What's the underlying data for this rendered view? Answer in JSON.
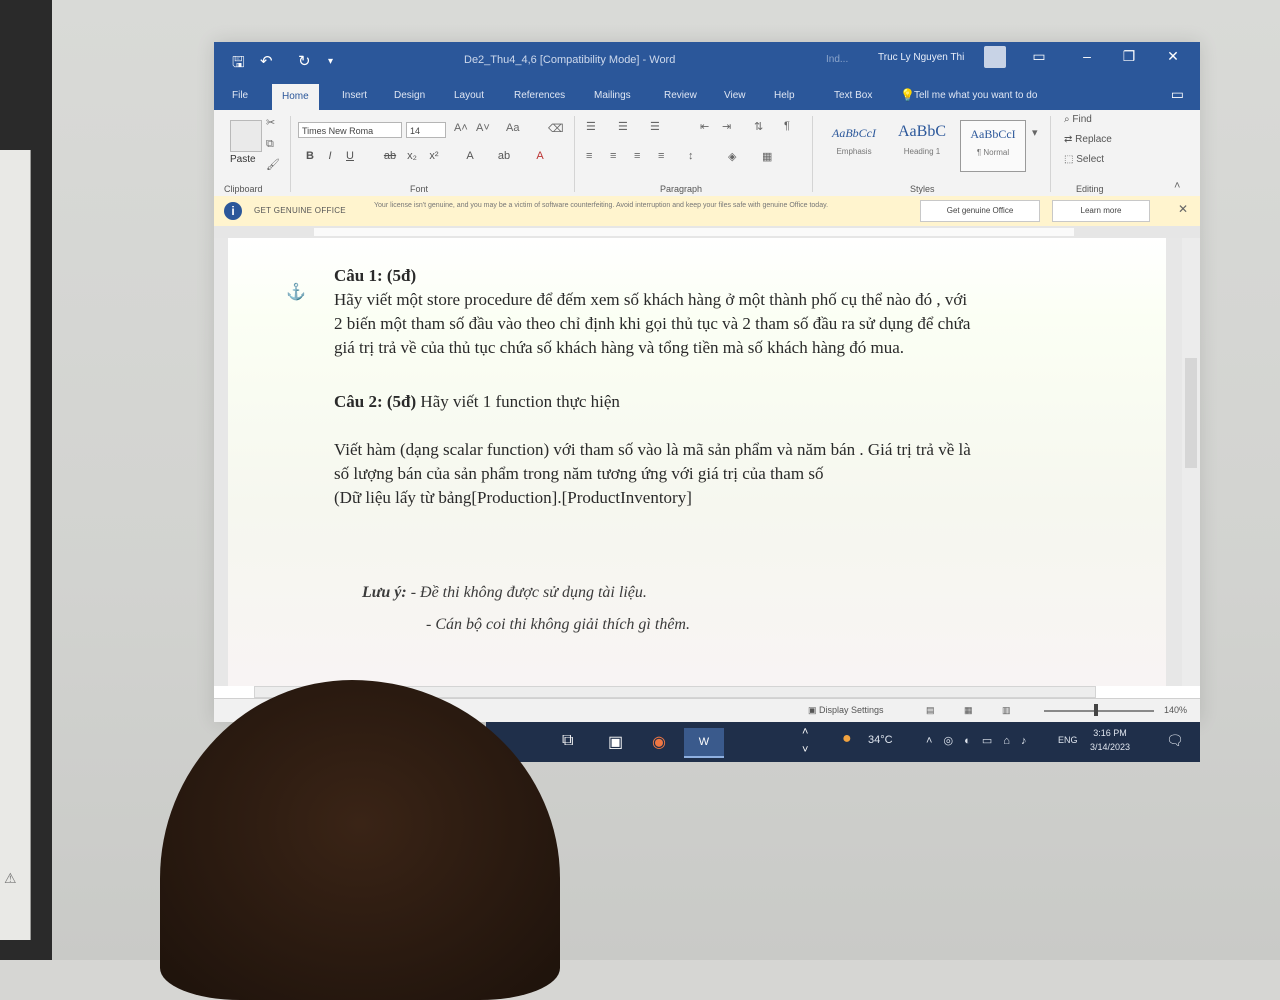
{
  "window": {
    "title": "De2_Thu4_4,6 [Compatibility Mode] - Word",
    "search_stub": "Ind...",
    "user": "Truc Ly Nguyen Thi"
  },
  "tabs": [
    {
      "label": "File"
    },
    {
      "label": "Home",
      "active": true
    },
    {
      "label": "Insert"
    },
    {
      "label": "Design"
    },
    {
      "label": "Layout"
    },
    {
      "label": "References"
    },
    {
      "label": "Mailings"
    },
    {
      "label": "Review"
    },
    {
      "label": "View"
    },
    {
      "label": "Help"
    },
    {
      "label": "Text Box"
    }
  ],
  "tell_me": "Tell me what you want to do",
  "ribbon": {
    "paste": "Paste",
    "font_name": "Times New Roma",
    "font_size": "14",
    "groups": {
      "clipboard": "Clipboard",
      "font": "Font",
      "paragraph": "Paragraph",
      "styles": "Styles",
      "editing": "Editing"
    },
    "styles": [
      {
        "sample": "AaBbCcI",
        "name": "Emphasis"
      },
      {
        "sample": "AaBbC",
        "name": "Heading 1"
      },
      {
        "sample": "AaBbCcI",
        "name": "¶ Normal"
      }
    ],
    "editing": {
      "find": "Find",
      "replace": "Replace",
      "select": "Select"
    }
  },
  "warning": {
    "title": "GET GENUINE OFFICE",
    "text": "Your license isn't genuine, and you may be a victim of software counterfeiting. Avoid interruption and keep your files safe with genuine Office today.",
    "btn_genuine": "Get genuine Office",
    "btn_learn": "Learn more"
  },
  "document": {
    "q1_head": "Câu 1: (5đ)",
    "q1_line1": "Hãy viết một store procedure để đếm xem số khách hàng ở một thành phố cụ thể nào đó , với",
    "q1_line2": "2 biến một tham số đầu vào theo chỉ định khi gọi thủ tục và 2 tham số đầu ra sử dụng để chứa",
    "q1_line3": "giá trị trả về của thủ tục chứa số khách hàng và tổng tiền mà số khách hàng đó mua.",
    "q2_head": "Câu 2: (5đ)",
    "q2_title_rest": " Hãy viết 1 function thực hiện",
    "q2_line1": "Viết hàm  (dạng scalar function) với tham số vào là mã sản phẩm và năm bán . Giá trị trả về là",
    "q2_line2": "số lượng bán của sản phẩm trong năm tương ứng với giá trị của tham số",
    "q2_line3": " (Dữ liệu lấy từ bảng[Production].[ProductInventory]",
    "note_label": "Lưu ý:",
    "note_1": " - Đề thi không được sử dụng tài liệu.",
    "note_2": "- Cán bộ coi thi không giải thích gì thêm."
  },
  "status": {
    "display_settings": "Display Settings",
    "zoom": "140%"
  },
  "taskbar": {
    "temperature": "34°C",
    "language": "ENG",
    "time": "3:16 PM",
    "date": "3/14/2023"
  }
}
